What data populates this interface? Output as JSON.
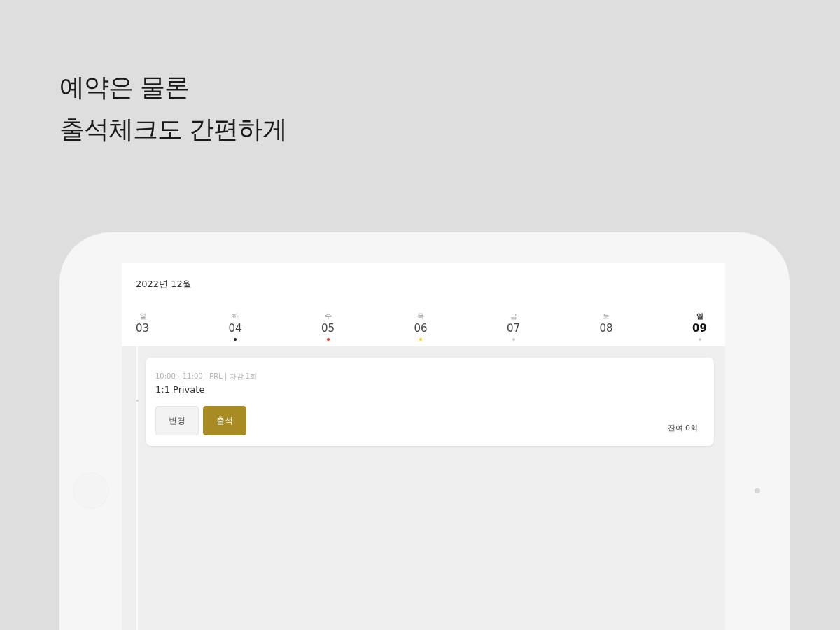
{
  "headline": [
    "예약은 물론",
    "출석체크도 간편하게"
  ],
  "calendar": {
    "month": "2022년 12월",
    "days": [
      {
        "weekday": "월",
        "date": "03",
        "selected": false
      },
      {
        "weekday": "화",
        "date": "04",
        "selected": false,
        "color": "#111111"
      },
      {
        "weekday": "수",
        "date": "05",
        "selected": false,
        "color": "#ff1a1a"
      },
      {
        "weekday": "목",
        "date": "06",
        "selected": false,
        "color": "#ffd400"
      },
      {
        "weekday": "금",
        "date": "07",
        "selected": false,
        "color": "#cccccc"
      },
      {
        "weekday": "토",
        "date": "08",
        "selected": false
      },
      {
        "weekday": "일",
        "date": "09",
        "selected": true,
        "color": "#cccccc"
      }
    ]
  },
  "sessions": [
    {
      "meta": "10:00 - 11:00 | PRL | 차감 1회",
      "title": "1:1 Private",
      "buttons": [
        {
          "label": "변경",
          "kind": "secondary"
        },
        {
          "label": "출석",
          "kind": "primary"
        }
      ],
      "remaining": "잔여 0회"
    }
  ]
}
